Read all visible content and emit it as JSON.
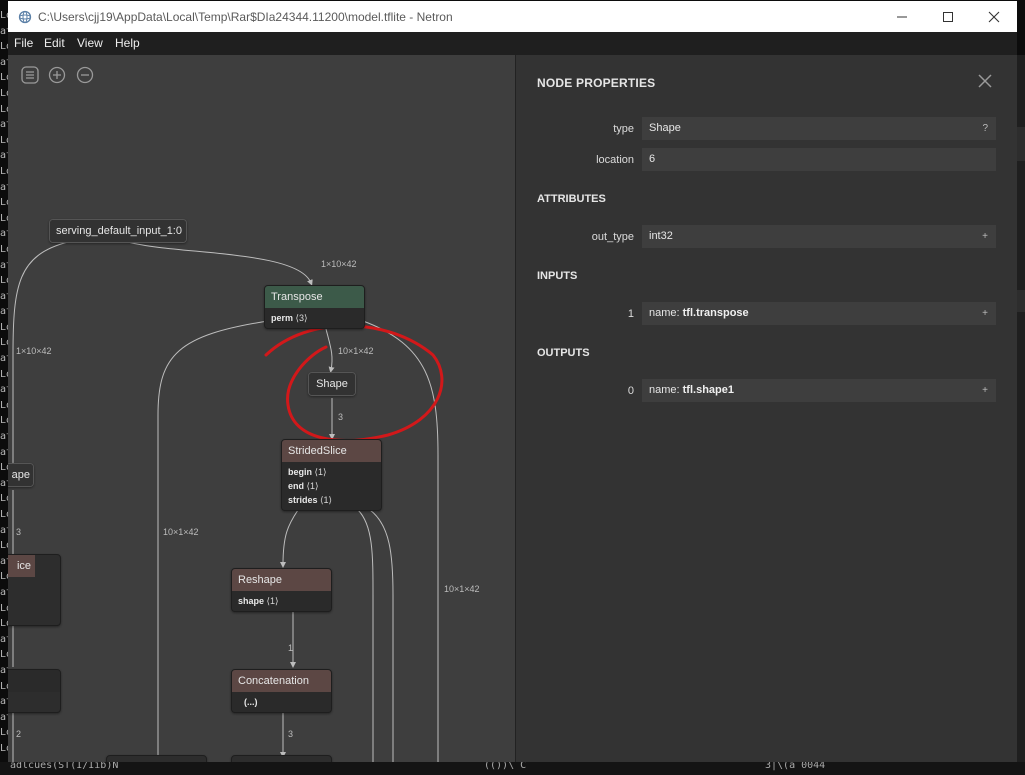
{
  "window": {
    "title": "C:\\Users\\cjj19\\AppData\\Local\\Temp\\Rar$DIa24344.11200\\model.tflite - Netron"
  },
  "menu": [
    "File",
    "Edit",
    "View",
    "Help"
  ],
  "graph": {
    "input_node": "serving_default_input_1:0",
    "nodes": {
      "transpose": {
        "title": "Transpose",
        "attr_name": "perm",
        "attr_value": "⟨3⟩"
      },
      "shape": {
        "title": "Shape"
      },
      "strided": {
        "title": "StridedSlice",
        "attrs": [
          {
            "name": "begin",
            "value": "⟨1⟩"
          },
          {
            "name": "end",
            "value": "⟨1⟩"
          },
          {
            "name": "strides",
            "value": "⟨1⟩"
          }
        ]
      },
      "reshape": {
        "title": "Reshape",
        "attr_name": "shape",
        "attr_value": "⟨1⟩"
      },
      "concat": {
        "title": "Concatenation",
        "attr_value": "(...)"
      },
      "left_shape": {
        "title": "ape"
      },
      "left_slice": {
        "title": "ice"
      }
    },
    "edge_labels": {
      "in_to_transpose": "1×10×42",
      "left_branch": "1×10×42",
      "transpose_to_shape": "10×1×42",
      "shape_to_strided": "3",
      "left_transpose_branch": "10×1×42",
      "right_transpose_branch": "10×1×42",
      "reshape_to_concat": "1",
      "concat_out": "3",
      "left_three": "3",
      "left_two": "2"
    }
  },
  "properties": {
    "title": "NODE PROPERTIES",
    "type_label": "type",
    "type_value": "Shape",
    "type_button": "?",
    "location_label": "location",
    "location_value": "6",
    "attributes_title": "ATTRIBUTES",
    "out_type_label": "out_type",
    "out_type_value": "int32",
    "inputs_title": "INPUTS",
    "input_index": "1",
    "input_name_prefix": "name: ",
    "input_name": "tfl.transpose",
    "outputs_title": "OUTPUTS",
    "output_index": "0",
    "output_name_prefix": "name: ",
    "output_name": "tfl.shape1",
    "expand_button": "+"
  },
  "background": {
    "left_lines": [
      "Lo",
      "at",
      "Lo",
      "at",
      "Lo",
      "Lo",
      "Lo",
      "at",
      "Lo",
      "at",
      "Lo",
      "at",
      "Lo",
      "Lo",
      "at",
      "Lo",
      "at",
      "Lo",
      "at",
      "at",
      "Lo",
      "Lo",
      "at",
      "Lo",
      "at",
      "Lo",
      "Lo",
      "at",
      "at",
      "Lo",
      "at",
      "Lo",
      "Lo",
      "at",
      "Lo",
      "at",
      "Lo",
      "at",
      "Lo",
      "Lo",
      "at",
      "Lo",
      "at",
      "Lo",
      "at",
      "at",
      "Lo",
      "Lo"
    ],
    "bottom_left": "adlcues(ST(I/Iib)N",
    "bottom_mid": "(())\\ C",
    "bottom_right": "3|\\(a 0044"
  },
  "colors": {
    "transpose_header": "#3c5a49",
    "strided_header": "#5c4744",
    "annotation_red": "#d2181a"
  }
}
